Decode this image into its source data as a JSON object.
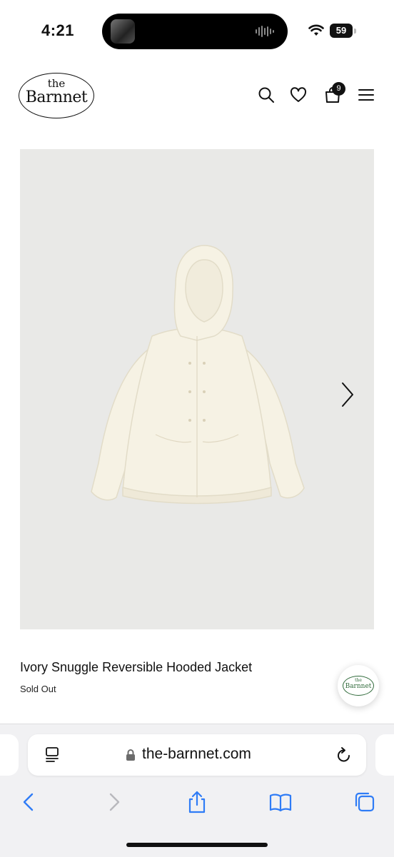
{
  "status_bar": {
    "time": "4:21",
    "battery_level": "59",
    "icons": [
      "now-playing-artwork",
      "audio-waveform-icon",
      "wifi-icon",
      "battery-icon"
    ]
  },
  "header": {
    "logo_the": "the",
    "logo_name": "Barnnet",
    "cart_count": "9",
    "icons": [
      "search-icon",
      "heart-icon",
      "bag-icon",
      "hamburger-menu-icon"
    ]
  },
  "product": {
    "title": "Ivory Snuggle Reversible Hooded Jacket",
    "status": "Sold Out",
    "image_background": "#e9e9e7"
  },
  "chat_widget": {
    "logo_the": "the",
    "logo_name": "Barnnet",
    "accent_color": "#2f6a3a"
  },
  "browser": {
    "url": "the-barnnet.com",
    "accent_color": "#2f7cf6",
    "icons": [
      "reader-mode-icon",
      "lock-icon",
      "reload-icon",
      "back-icon",
      "forward-icon",
      "share-icon",
      "bookmarks-icon",
      "tabs-icon"
    ]
  }
}
